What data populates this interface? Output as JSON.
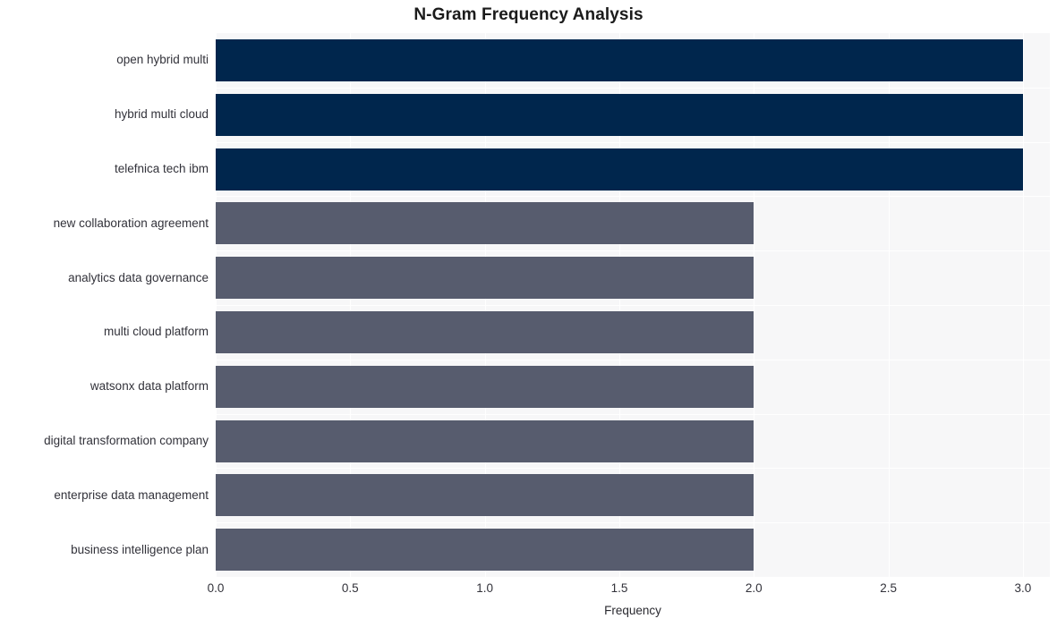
{
  "chart_data": {
    "type": "bar",
    "orientation": "horizontal",
    "title": "N-Gram Frequency Analysis",
    "xlabel": "Frequency",
    "ylabel": "",
    "categories": [
      "open hybrid multi",
      "hybrid multi cloud",
      "telefnica tech ibm",
      "new collaboration agreement",
      "analytics data governance",
      "multi cloud platform",
      "watsonx data platform",
      "digital transformation company",
      "enterprise data management",
      "business intelligence plan"
    ],
    "values": [
      3,
      3,
      3,
      2,
      2,
      2,
      2,
      2,
      2,
      2
    ],
    "bar_colors": [
      "#00264d",
      "#00264d",
      "#00264d",
      "#575c6e",
      "#575c6e",
      "#575c6e",
      "#575c6e",
      "#575c6e",
      "#575c6e",
      "#575c6e"
    ],
    "xlim": [
      0.0,
      3.1
    ],
    "xticks": [
      0.0,
      0.5,
      1.0,
      1.5,
      2.0,
      2.5,
      3.0
    ],
    "xtick_labels": [
      "0.0",
      "0.5",
      "1.0",
      "1.5",
      "2.0",
      "2.5",
      "3.0"
    ],
    "grid": true,
    "grid_color": "#ffffff",
    "plot_background": "#f7f7f8",
    "figure_background": "#ffffff",
    "legend": null,
    "legend_position": "none"
  },
  "style": {
    "title_color": "#1b1b1b",
    "tick_label_color": "#32323a",
    "axis_label_color": "#2a2a30",
    "highlight_color": "#00264d",
    "secondary_color": "#575c6e"
  }
}
